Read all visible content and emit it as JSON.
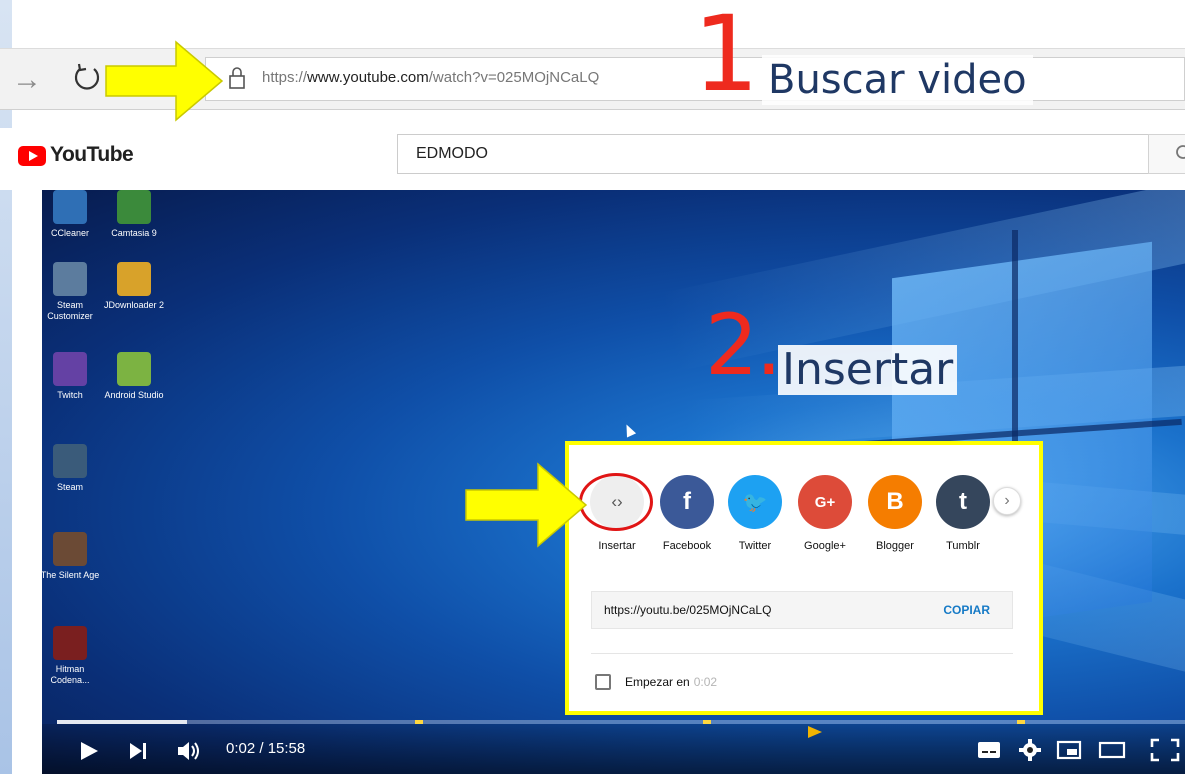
{
  "browser": {
    "url_prefix": "https://",
    "url_host": "www.youtube.com",
    "url_path": "/watch?v=025MOjNCaLQ"
  },
  "annotations": {
    "step1_number": "1",
    "step1_label": "Buscar video",
    "step2_number": "2.",
    "step2_label": "Insertar"
  },
  "youtube": {
    "logo_text": "YouTube",
    "search_value": "EDMODO"
  },
  "desktop_icons": [
    {
      "label": "CCleaner",
      "color": "#2f6fb5"
    },
    {
      "label": "Camtasia 9",
      "color": "#3b8a3b"
    },
    {
      "label": "Steam Customizer",
      "color": "#5c7c9e"
    },
    {
      "label": "JDownloader 2",
      "color": "#d8a22a"
    },
    {
      "label": "Twitch",
      "color": "#6441a4"
    },
    {
      "label": "Android Studio",
      "color": "#7cb342"
    },
    {
      "label": "Steam",
      "color": "#3a5b7a"
    },
    {
      "label": "The Silent Age",
      "color": "#6b4a35"
    },
    {
      "label": "Hitman Codena...",
      "color": "#7a1f1f"
    }
  ],
  "share": {
    "buttons": [
      {
        "label": "Insertar",
        "glyph": "‹›",
        "color": "#eeeeee"
      },
      {
        "label": "Facebook",
        "glyph": "f",
        "color": "#3b5998"
      },
      {
        "label": "Twitter",
        "glyph": "🐦",
        "color": "#1da1f2"
      },
      {
        "label": "Google+",
        "glyph": "G+",
        "color": "#dd4b39"
      },
      {
        "label": "Blogger",
        "glyph": "B",
        "color": "#f57d00"
      },
      {
        "label": "Tumblr",
        "glyph": "t",
        "color": "#35465c"
      }
    ],
    "link": "https://youtu.be/025MOjNCaLQ",
    "copy_label": "COPIAR",
    "start_label": "Empezar en",
    "start_time": "0:02"
  },
  "player": {
    "time_display": "0:02 / 15:58",
    "progress_fraction": 0.007
  },
  "colors": {
    "annotation_red": "#ee2a1e",
    "annotation_blue": "#1f3864",
    "highlight_yellow": "#ffff00",
    "youtube_red": "#ff0000",
    "link_blue": "#167ac6"
  }
}
